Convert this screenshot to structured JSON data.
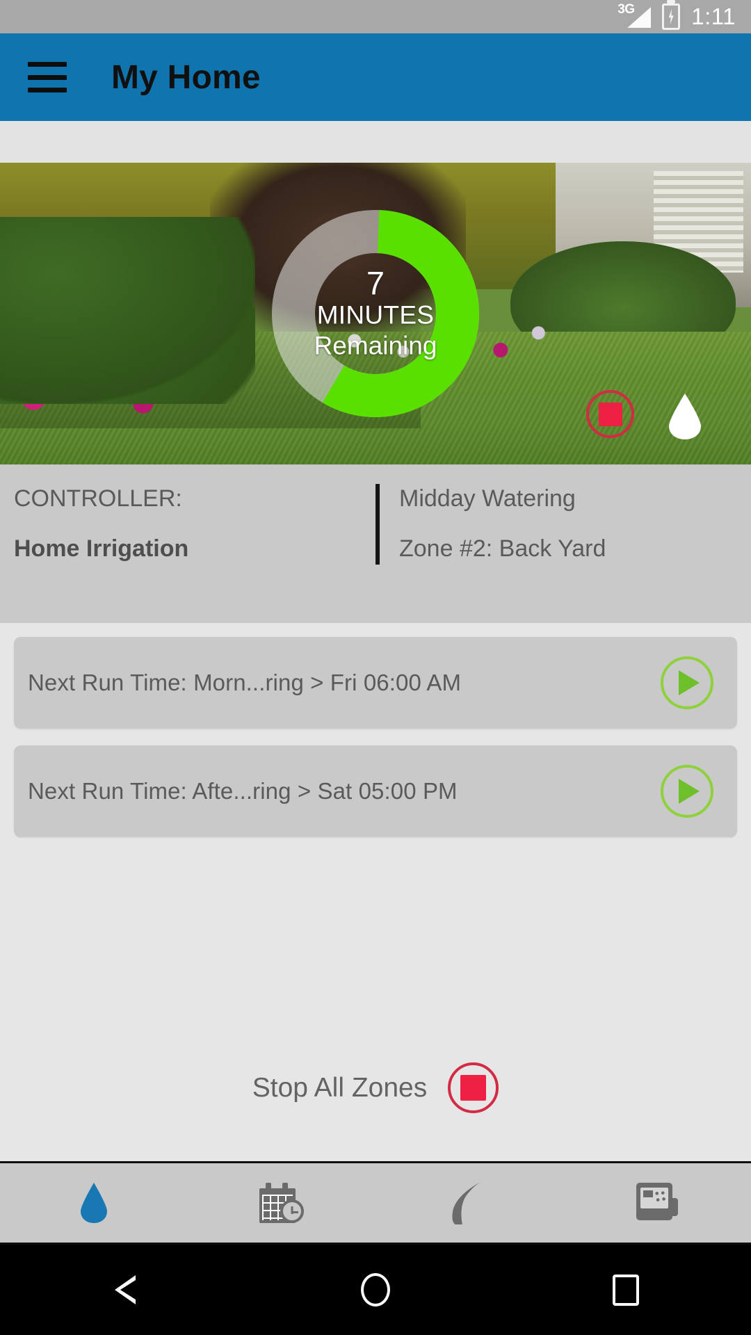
{
  "status_bar": {
    "network_type": "3G",
    "time": "1:11",
    "battery_icon": "battery-charging-icon",
    "signal_icon": "signal-bars-icon"
  },
  "app_bar": {
    "menu_icon": "hamburger-menu-icon",
    "title": "My Home",
    "background_color": "#1075ae"
  },
  "hero": {
    "progress": {
      "value": "7",
      "unit": "MINUTES",
      "sublabel": "Remaining",
      "percent": 58,
      "arc_color": "#5ae000",
      "track_color": "rgba(230,230,230,0.55)"
    },
    "stop_icon": "stop-circle-icon",
    "drop_icon": "water-drop-icon"
  },
  "controller_info": {
    "label": "CONTROLLER:",
    "name": "Home Irrigation",
    "program": "Midday Watering",
    "zone": "Zone #2: Back Yard"
  },
  "run_times": [
    {
      "label": "Next Run Time:  Morn...ring > Fri 06:00 AM",
      "play_icon": "play-circle-icon"
    },
    {
      "label": "Next Run Time:  Afte...ring > Sat 05:00 PM",
      "play_icon": "play-circle-icon"
    }
  ],
  "stop_all": {
    "label": "Stop All Zones",
    "icon": "stop-circle-icon",
    "color": "#ee2144"
  },
  "tabs": [
    {
      "name": "watering",
      "icon": "water-drop-icon",
      "active": true,
      "color": "#1878b4"
    },
    {
      "name": "schedule",
      "icon": "calendar-clock-icon",
      "active": false,
      "color": "#6b6b6b"
    },
    {
      "name": "seasonal",
      "icon": "leaf-icon",
      "active": false,
      "color": "#6b6b6b"
    },
    {
      "name": "controller",
      "icon": "controller-device-icon",
      "active": false,
      "color": "#6b6b6b"
    }
  ],
  "android_nav": {
    "back_icon": "triangle-back-icon",
    "home_icon": "circle-home-icon",
    "recents_icon": "square-recents-icon"
  }
}
